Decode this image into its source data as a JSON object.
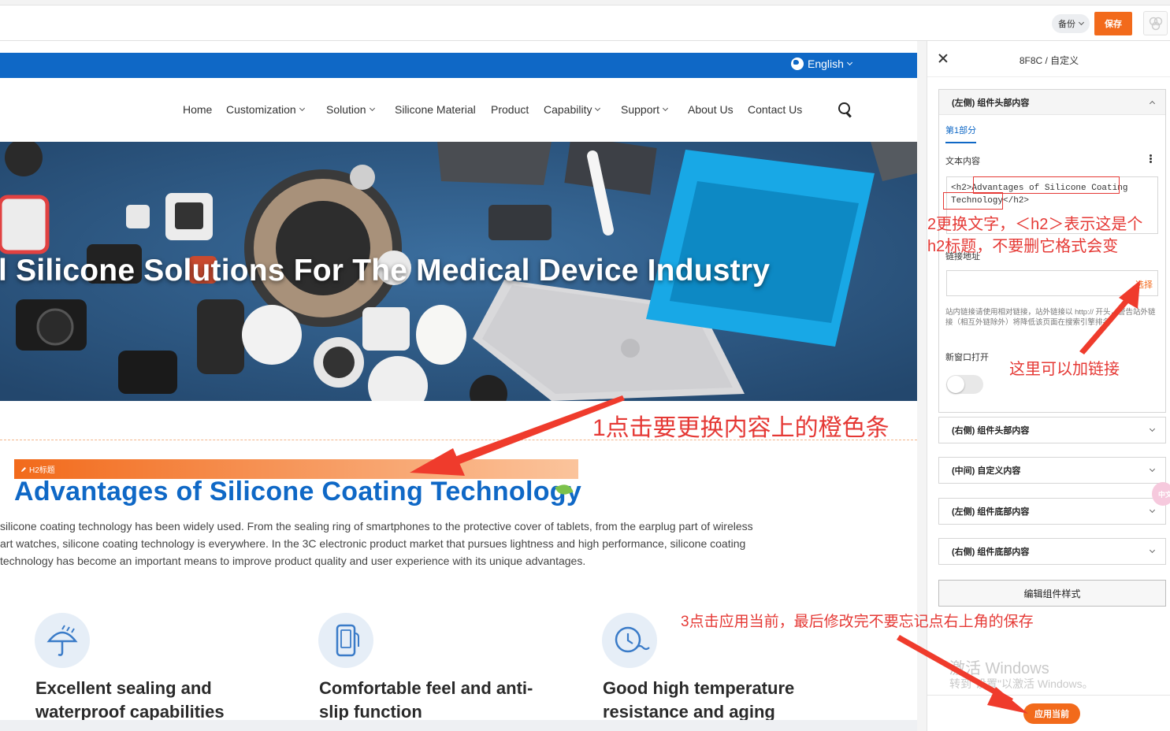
{
  "toolbar": {
    "backup_label": "备份",
    "save_label": "保存"
  },
  "site": {
    "language": "English",
    "nav": [
      {
        "label": "Home",
        "dropdown": false
      },
      {
        "label": "Customization",
        "dropdown": true
      },
      {
        "label": "Solution",
        "dropdown": true
      },
      {
        "label": "Silicone Material",
        "dropdown": false
      },
      {
        "label": "Product",
        "dropdown": false
      },
      {
        "label": "Capability",
        "dropdown": true
      },
      {
        "label": "Support",
        "dropdown": true
      },
      {
        "label": "About Us",
        "dropdown": false
      },
      {
        "label": "Contact Us",
        "dropdown": false
      }
    ],
    "banner_title": "l Silicone Solutions For The Medical Device Industry",
    "h2_tag": "H2标题",
    "h2_title": "Advantages of Silicone Coating Technology",
    "paragraph": [
      " silicone coating technology has been widely used. From the sealing ring of smartphones to the protective cover of tablets, from the earplug part of wireless",
      "art watches, silicone coating technology is everywhere. In the 3C electronic product market that pursues lightness and high performance, silicone coating",
      " technology has become an important means to improve product quality and user experience with its unique advantages."
    ],
    "features": [
      {
        "icon": "umbrella-icon",
        "title": "Excellent sealing and\nwaterproof capabilities"
      },
      {
        "icon": "phone-icon",
        "title": "Comfortable feel and anti-\nslip function"
      },
      {
        "icon": "temperature-clock-icon",
        "title": "Good high temperature\nresistance and aging"
      }
    ]
  },
  "panel": {
    "title": "8F8C / 自定义",
    "open_section": {
      "title": "(左侧) 组件头部内容",
      "tab": "第1部分",
      "text_label": "文本内容",
      "text_line1": "<h2>Advantages of Silicone Coating",
      "text_line2": "Technology</h2>",
      "link_label": "链接地址",
      "select_label": "选择",
      "hint": "站内链接请使用相对链接，站外链接以 http:// 开头，警告站外链接（相互外链除外）将降低该页面在搜索引擎排名",
      "new_window_label": "新窗口打开"
    },
    "sections": [
      "(右侧) 组件头部内容",
      "(中间) 自定义内容",
      "(左侧) 组件底部内容",
      "(右侧) 组件底部内容"
    ],
    "edit_style_label": "编辑组件样式",
    "watermark_title": "激活 Windows",
    "watermark_sub": "转到\"设置\"以激活 Windows。",
    "apply_label": "应用当前",
    "side_badge": "中文"
  },
  "annotations": {
    "step1": "1点击要更换内容上的橙色条",
    "step2_line1": "2更换文字，＜h2＞表示这是个",
    "step2_line2": "h2标题，不要删它格式会变",
    "link_note": "这里可以加链接",
    "step3": "3点击应用当前，最后修改完不要忘记点右上角的保存"
  },
  "colors": {
    "accent_orange": "#f26a1b",
    "brand_blue": "#0f68c6",
    "annotation_red": "#e53935"
  }
}
